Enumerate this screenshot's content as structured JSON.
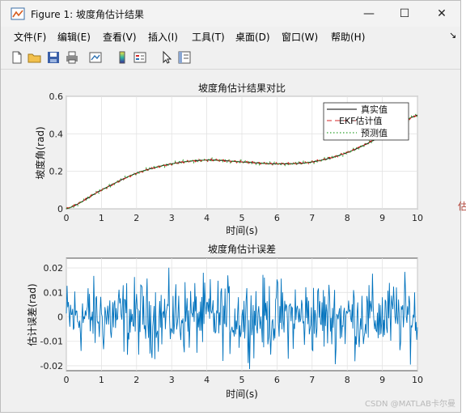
{
  "window": {
    "title": "Figure 1: 坡度角估计结果",
    "controls": {
      "minimize": "—",
      "maximize": "☐",
      "close": "✕"
    }
  },
  "menu": [
    "文件(F)",
    "编辑(E)",
    "查看(V)",
    "插入(I)",
    "工具(T)",
    "桌面(D)",
    "窗口(W)",
    "帮助(H)"
  ],
  "menu_arrow": "↘",
  "toolbar": [
    "new-figure-icon",
    "open-folder-icon",
    "save-icon",
    "print-icon",
    "link-plot-icon",
    "colorbar-icon",
    "legend-icon",
    "pointer-icon",
    "property-editor-icon"
  ],
  "watermark": "CSDN @MATLAB卡尔曼",
  "edge_text": "估",
  "colors": {
    "true": "#000000",
    "ekf": "#d62728",
    "pred": "#2ca02c",
    "error": "#0072bd"
  },
  "chart_data": [
    {
      "type": "line",
      "title": "坡度角估计结果对比",
      "xlabel": "时间(s)",
      "ylabel": "坡度角(rad)",
      "xlim": [
        0,
        10
      ],
      "ylim": [
        0,
        0.6
      ],
      "xticks": [
        "0",
        "1",
        "2",
        "3",
        "4",
        "5",
        "6",
        "7",
        "8",
        "9",
        "10"
      ],
      "yticks": [
        "0",
        "0.2",
        "0.4",
        "0.6"
      ],
      "grid": true,
      "legend_position": "top-right",
      "series": [
        {
          "name": "真实值",
          "style": "solid",
          "x": [
            0,
            1,
            2,
            3,
            4,
            5,
            6,
            7,
            8,
            9,
            10
          ],
          "values": [
            0.0,
            0.1,
            0.19,
            0.24,
            0.26,
            0.25,
            0.24,
            0.25,
            0.3,
            0.39,
            0.5
          ]
        },
        {
          "name": "EKF估计值",
          "style": "dashed",
          "x": [
            0,
            1,
            2,
            3,
            4,
            5,
            6,
            7,
            8,
            9,
            10
          ],
          "values": [
            0.0,
            0.1,
            0.19,
            0.24,
            0.26,
            0.25,
            0.24,
            0.25,
            0.3,
            0.39,
            0.5
          ]
        },
        {
          "name": "预测值",
          "style": "dotted",
          "x": [
            0,
            1,
            2,
            3,
            4,
            5,
            6,
            7,
            8,
            9,
            10
          ],
          "values": [
            0.0,
            0.1,
            0.19,
            0.24,
            0.26,
            0.25,
            0.24,
            0.25,
            0.3,
            0.39,
            0.5
          ]
        }
      ]
    },
    {
      "type": "line",
      "title": "坡度角估计误差",
      "xlabel": "时间(s)",
      "ylabel": "估计误差(rad)",
      "xlim": [
        0,
        10
      ],
      "ylim": [
        -0.022,
        0.024
      ],
      "xticks": [
        "0",
        "1",
        "2",
        "3",
        "4",
        "5",
        "6",
        "7",
        "8",
        "9",
        "10"
      ],
      "yticks": [
        "0.02",
        "0.01",
        "0",
        "-0.01",
        "-0.02"
      ],
      "grid": true,
      "series": [
        {
          "name": "",
          "style": "solid",
          "x_start": 0,
          "x_step": 0.02,
          "amplitude": 0.02,
          "count": 501
        }
      ]
    }
  ]
}
